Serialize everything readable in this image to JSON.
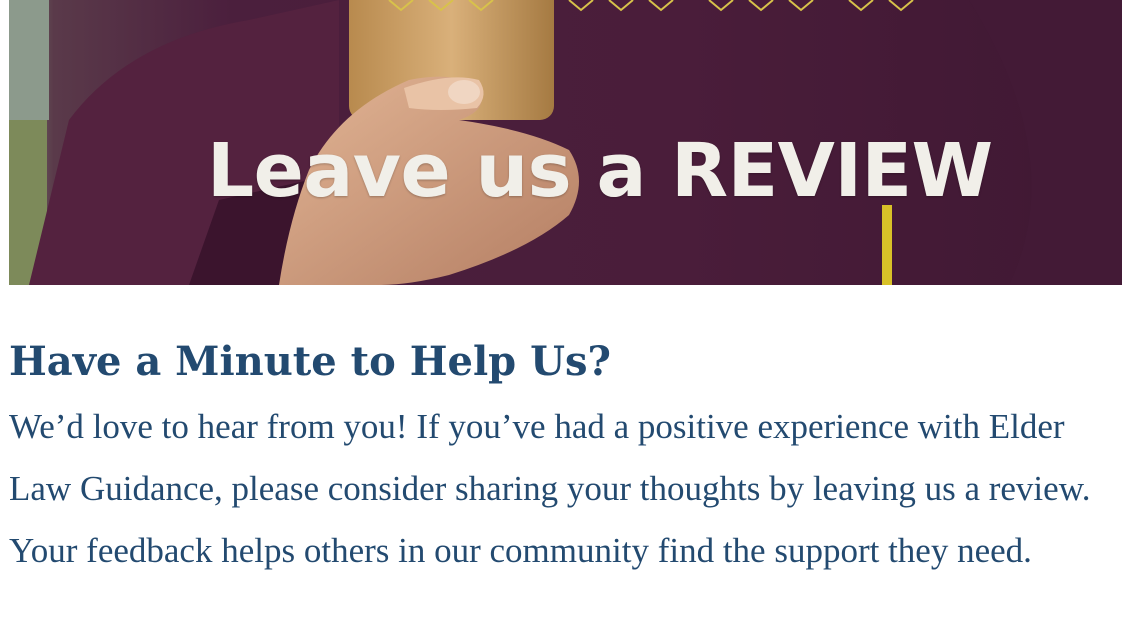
{
  "hero": {
    "banner_text": "Leave us a REVIEW",
    "colors": {
      "background": "#4a1d3a",
      "text": "#f1efe9",
      "star": "#d8c24a"
    }
  },
  "content": {
    "heading": "Have a Minute to Help Us?",
    "paragraph": "We’d love to hear from you! If you’ve had a positive experience with Elder Law Guidance, please consider sharing your thoughts by leaving us a review. Your feedback helps others in our community find the support they need.",
    "text_color": "#234a70"
  }
}
